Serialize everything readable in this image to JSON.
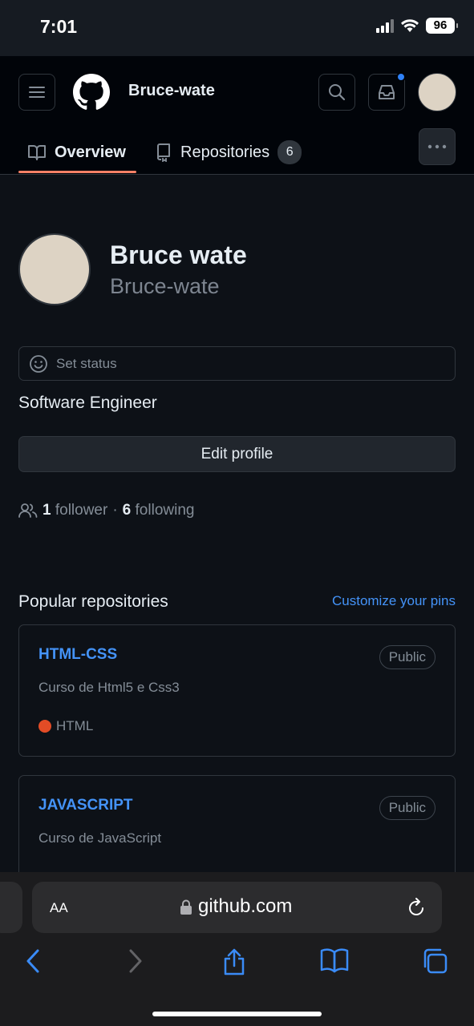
{
  "status_bar": {
    "time": "7:01",
    "battery": "96"
  },
  "header": {
    "username": "Bruce-wate",
    "tabs": [
      {
        "label": "Overview"
      },
      {
        "label": "Repositories",
        "count": "6"
      }
    ]
  },
  "profile": {
    "name": "Bruce wate",
    "login": "Bruce-wate",
    "set_status_label": "Set status",
    "bio": "Software Engineer",
    "edit_profile_label": "Edit profile",
    "followers_count": "1",
    "followers_label": "follower",
    "separator": "·",
    "following_count": "6",
    "following_label": "following"
  },
  "popular": {
    "title": "Popular repositories",
    "customize_label": "Customize your pins",
    "repos": [
      {
        "name": "HTML-CSS",
        "visibility": "Public",
        "description": "Curso de Html5 e Css3",
        "language": "HTML",
        "language_color": "#e34c26"
      },
      {
        "name": "JAVASCRIPT",
        "visibility": "Public",
        "description": "Curso de JavaScript"
      }
    ]
  },
  "browser": {
    "aa_label": "AA",
    "url": "github.com"
  },
  "colors": {
    "accent_link": "#4493f8",
    "tab_underline": "#f78166",
    "bg": "#0d1117"
  }
}
